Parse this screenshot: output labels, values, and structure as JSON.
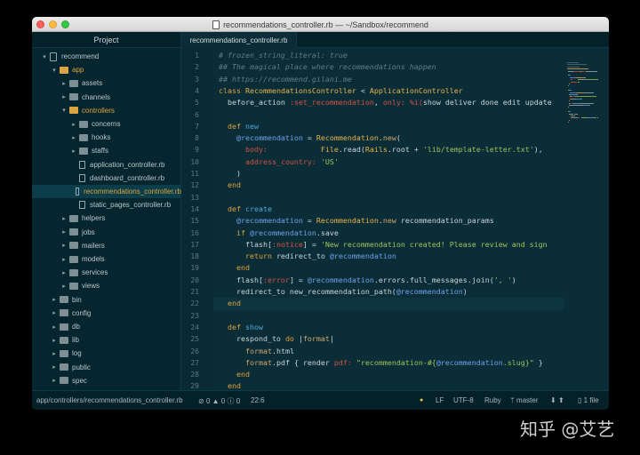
{
  "window": {
    "title": "recommendations_controller.rb — ~/Sandbox/recommend"
  },
  "sidebar": {
    "header": "Project",
    "items": [
      {
        "label": "recommend",
        "kind": "repo",
        "depth": 0,
        "state": "open"
      },
      {
        "label": "app",
        "kind": "folder",
        "depth": 1,
        "state": "open"
      },
      {
        "label": "assets",
        "kind": "folder",
        "depth": 2,
        "state": "closed"
      },
      {
        "label": "channels",
        "kind": "folder",
        "depth": 2,
        "state": "closed"
      },
      {
        "label": "controllers",
        "kind": "folder",
        "depth": 2,
        "state": "open"
      },
      {
        "label": "concerns",
        "kind": "folder",
        "depth": 3,
        "state": "closed"
      },
      {
        "label": "hooks",
        "kind": "folder",
        "depth": 3,
        "state": "closed"
      },
      {
        "label": "staffs",
        "kind": "folder",
        "depth": 3,
        "state": "closed"
      },
      {
        "label": "application_controller.rb",
        "kind": "file",
        "depth": 3
      },
      {
        "label": "dashboard_controller.rb",
        "kind": "file",
        "depth": 3
      },
      {
        "label": "recommendations_controller.rb",
        "kind": "file",
        "depth": 3,
        "selected": true
      },
      {
        "label": "static_pages_controller.rb",
        "kind": "file",
        "depth": 3
      },
      {
        "label": "helpers",
        "kind": "folder",
        "depth": 2,
        "state": "closed"
      },
      {
        "label": "jobs",
        "kind": "folder",
        "depth": 2,
        "state": "closed"
      },
      {
        "label": "mailers",
        "kind": "folder",
        "depth": 2,
        "state": "closed"
      },
      {
        "label": "models",
        "kind": "folder",
        "depth": 2,
        "state": "closed"
      },
      {
        "label": "services",
        "kind": "folder",
        "depth": 2,
        "state": "closed"
      },
      {
        "label": "views",
        "kind": "folder",
        "depth": 2,
        "state": "closed"
      },
      {
        "label": "bin",
        "kind": "folder",
        "depth": 1,
        "state": "closed"
      },
      {
        "label": "config",
        "kind": "folder",
        "depth": 1,
        "state": "closed"
      },
      {
        "label": "db",
        "kind": "folder",
        "depth": 1,
        "state": "closed"
      },
      {
        "label": "lib",
        "kind": "folder",
        "depth": 1,
        "state": "closed"
      },
      {
        "label": "log",
        "kind": "folder",
        "depth": 1,
        "state": "closed"
      },
      {
        "label": "public",
        "kind": "folder",
        "depth": 1,
        "state": "closed"
      },
      {
        "label": "spec",
        "kind": "folder",
        "depth": 1,
        "state": "closed"
      }
    ]
  },
  "editor": {
    "tab_label": "recommendations_controller.rb",
    "current_line": 22,
    "lines": [
      {
        "n": "1",
        "tokens": [
          [
            "com",
            "# frozen_string_literal: true"
          ]
        ]
      },
      {
        "n": "2",
        "tokens": [
          [
            "com",
            "## The magical place where recommendations happen"
          ]
        ]
      },
      {
        "n": "3",
        "tokens": [
          [
            "com",
            "## https://recommend.gilani.me"
          ]
        ]
      },
      {
        "n": "4",
        "tokens": [
          [
            "kw",
            "class "
          ],
          [
            "cls",
            "RecommendationsController"
          ],
          [
            "pl",
            " < "
          ],
          [
            "cls",
            "ApplicationController"
          ]
        ]
      },
      {
        "n": "5",
        "tokens": [
          [
            "pl",
            "  before_action "
          ],
          [
            "sym",
            ":set_recommendation"
          ],
          [
            "pl",
            ", "
          ],
          [
            "sym",
            "only:"
          ],
          [
            "pl",
            " "
          ],
          [
            "sym",
            "%i("
          ],
          [
            "pl",
            "show deliver done edit update"
          ]
        ]
      },
      {
        "n": "6",
        "tokens": []
      },
      {
        "n": "7",
        "tokens": [
          [
            "kw",
            "  def "
          ],
          [
            "def",
            "new"
          ]
        ]
      },
      {
        "n": "8",
        "tokens": [
          [
            "pl",
            "    "
          ],
          [
            "ivar",
            "@recommendation"
          ],
          [
            "pl",
            " = "
          ],
          [
            "cls",
            "Recommendation"
          ],
          [
            "pl",
            "."
          ],
          [
            "fn",
            "new"
          ],
          [
            "pl",
            "("
          ]
        ]
      },
      {
        "n": "9",
        "tokens": [
          [
            "pl",
            "      "
          ],
          [
            "sym",
            "body:"
          ],
          [
            "pl",
            "            "
          ],
          [
            "cls",
            "File"
          ],
          [
            "pl",
            ".read("
          ],
          [
            "cls",
            "Rails"
          ],
          [
            "pl",
            ".root + "
          ],
          [
            "str",
            "'lib/template-letter.txt'"
          ],
          [
            "pl",
            "),"
          ]
        ]
      },
      {
        "n": "10",
        "tokens": [
          [
            "pl",
            "      "
          ],
          [
            "sym",
            "address_country:"
          ],
          [
            "pl",
            " "
          ],
          [
            "str",
            "'US'"
          ]
        ]
      },
      {
        "n": "11",
        "tokens": [
          [
            "pl",
            "    )"
          ]
        ]
      },
      {
        "n": "12",
        "tokens": [
          [
            "kw",
            "  end"
          ]
        ]
      },
      {
        "n": "13",
        "tokens": []
      },
      {
        "n": "14",
        "tokens": [
          [
            "kw",
            "  def "
          ],
          [
            "def",
            "create"
          ]
        ]
      },
      {
        "n": "15",
        "tokens": [
          [
            "pl",
            "    "
          ],
          [
            "ivar",
            "@recommendation"
          ],
          [
            "pl",
            " = "
          ],
          [
            "cls",
            "Recommendation"
          ],
          [
            "pl",
            "."
          ],
          [
            "fn",
            "new"
          ],
          [
            "pl",
            " recommendation_params"
          ]
        ]
      },
      {
        "n": "16",
        "tokens": [
          [
            "kw",
            "    if "
          ],
          [
            "ivar",
            "@recommendation"
          ],
          [
            "pl",
            ".save"
          ]
        ]
      },
      {
        "n": "17",
        "tokens": [
          [
            "pl",
            "      flash["
          ],
          [
            "sym",
            ":notice"
          ],
          [
            "pl",
            "] = "
          ],
          [
            "str",
            "'New recommendation created! Please review and sign"
          ]
        ]
      },
      {
        "n": "18",
        "tokens": [
          [
            "kw",
            "      return "
          ],
          [
            "pl",
            "redirect_to "
          ],
          [
            "ivar",
            "@recommendation"
          ]
        ]
      },
      {
        "n": "19",
        "tokens": [
          [
            "kw",
            "    end"
          ]
        ]
      },
      {
        "n": "20",
        "tokens": [
          [
            "pl",
            "    flash["
          ],
          [
            "sym",
            ":error"
          ],
          [
            "pl",
            "] = "
          ],
          [
            "ivar",
            "@recommendation"
          ],
          [
            "pl",
            ".errors.full_messages.join("
          ],
          [
            "str",
            "', '"
          ],
          [
            "pl",
            ")"
          ]
        ]
      },
      {
        "n": "21",
        "tokens": [
          [
            "pl",
            "    redirect_to new_recommendation_path("
          ],
          [
            "ivar",
            "@recommendation"
          ],
          [
            "pl",
            ")"
          ]
        ]
      },
      {
        "n": "22",
        "tokens": [
          [
            "kw",
            "  end"
          ]
        ]
      },
      {
        "n": "23",
        "tokens": []
      },
      {
        "n": "24",
        "tokens": [
          [
            "kw",
            "  def "
          ],
          [
            "def",
            "show"
          ]
        ]
      },
      {
        "n": "25",
        "tokens": [
          [
            "pl",
            "    respond_to "
          ],
          [
            "kw",
            "do"
          ],
          [
            "pl",
            " |"
          ],
          [
            "fn",
            "format"
          ],
          [
            "pl",
            "|"
          ]
        ]
      },
      {
        "n": "26",
        "tokens": [
          [
            "pl",
            "      "
          ],
          [
            "fn",
            "format"
          ],
          [
            "pl",
            ".html"
          ]
        ]
      },
      {
        "n": "27",
        "tokens": [
          [
            "pl",
            "      "
          ],
          [
            "fn",
            "format"
          ],
          [
            "pl",
            ".pdf { render "
          ],
          [
            "sym",
            "pdf:"
          ],
          [
            "pl",
            " "
          ],
          [
            "str",
            "\"recommendation-#{"
          ],
          [
            "ivar",
            "@recommendation"
          ],
          [
            "str",
            ".slug}\""
          ],
          [
            "pl",
            " }"
          ]
        ]
      },
      {
        "n": "28",
        "tokens": [
          [
            "kw",
            "    end"
          ]
        ]
      },
      {
        "n": "29",
        "tokens": [
          [
            "kw",
            "  end"
          ]
        ]
      }
    ]
  },
  "statusbar": {
    "path": "app/controllers/recommendations_controller.rb",
    "errors": "0",
    "warnings": "0",
    "infos": "0",
    "cursor": "22:6",
    "line_ending": "LF",
    "encoding": "UTF-8",
    "grammar": "Ruby",
    "branch": "master",
    "file_count": "1 file"
  },
  "watermark": "知乎 @艾艺",
  "colors": {
    "background": "#0a2d38",
    "sidebar": "#06262f",
    "keyword": "#e0a13c",
    "string": "#9fc35a",
    "instance_var": "#6fa1e8",
    "symbol": "#d5513f"
  }
}
